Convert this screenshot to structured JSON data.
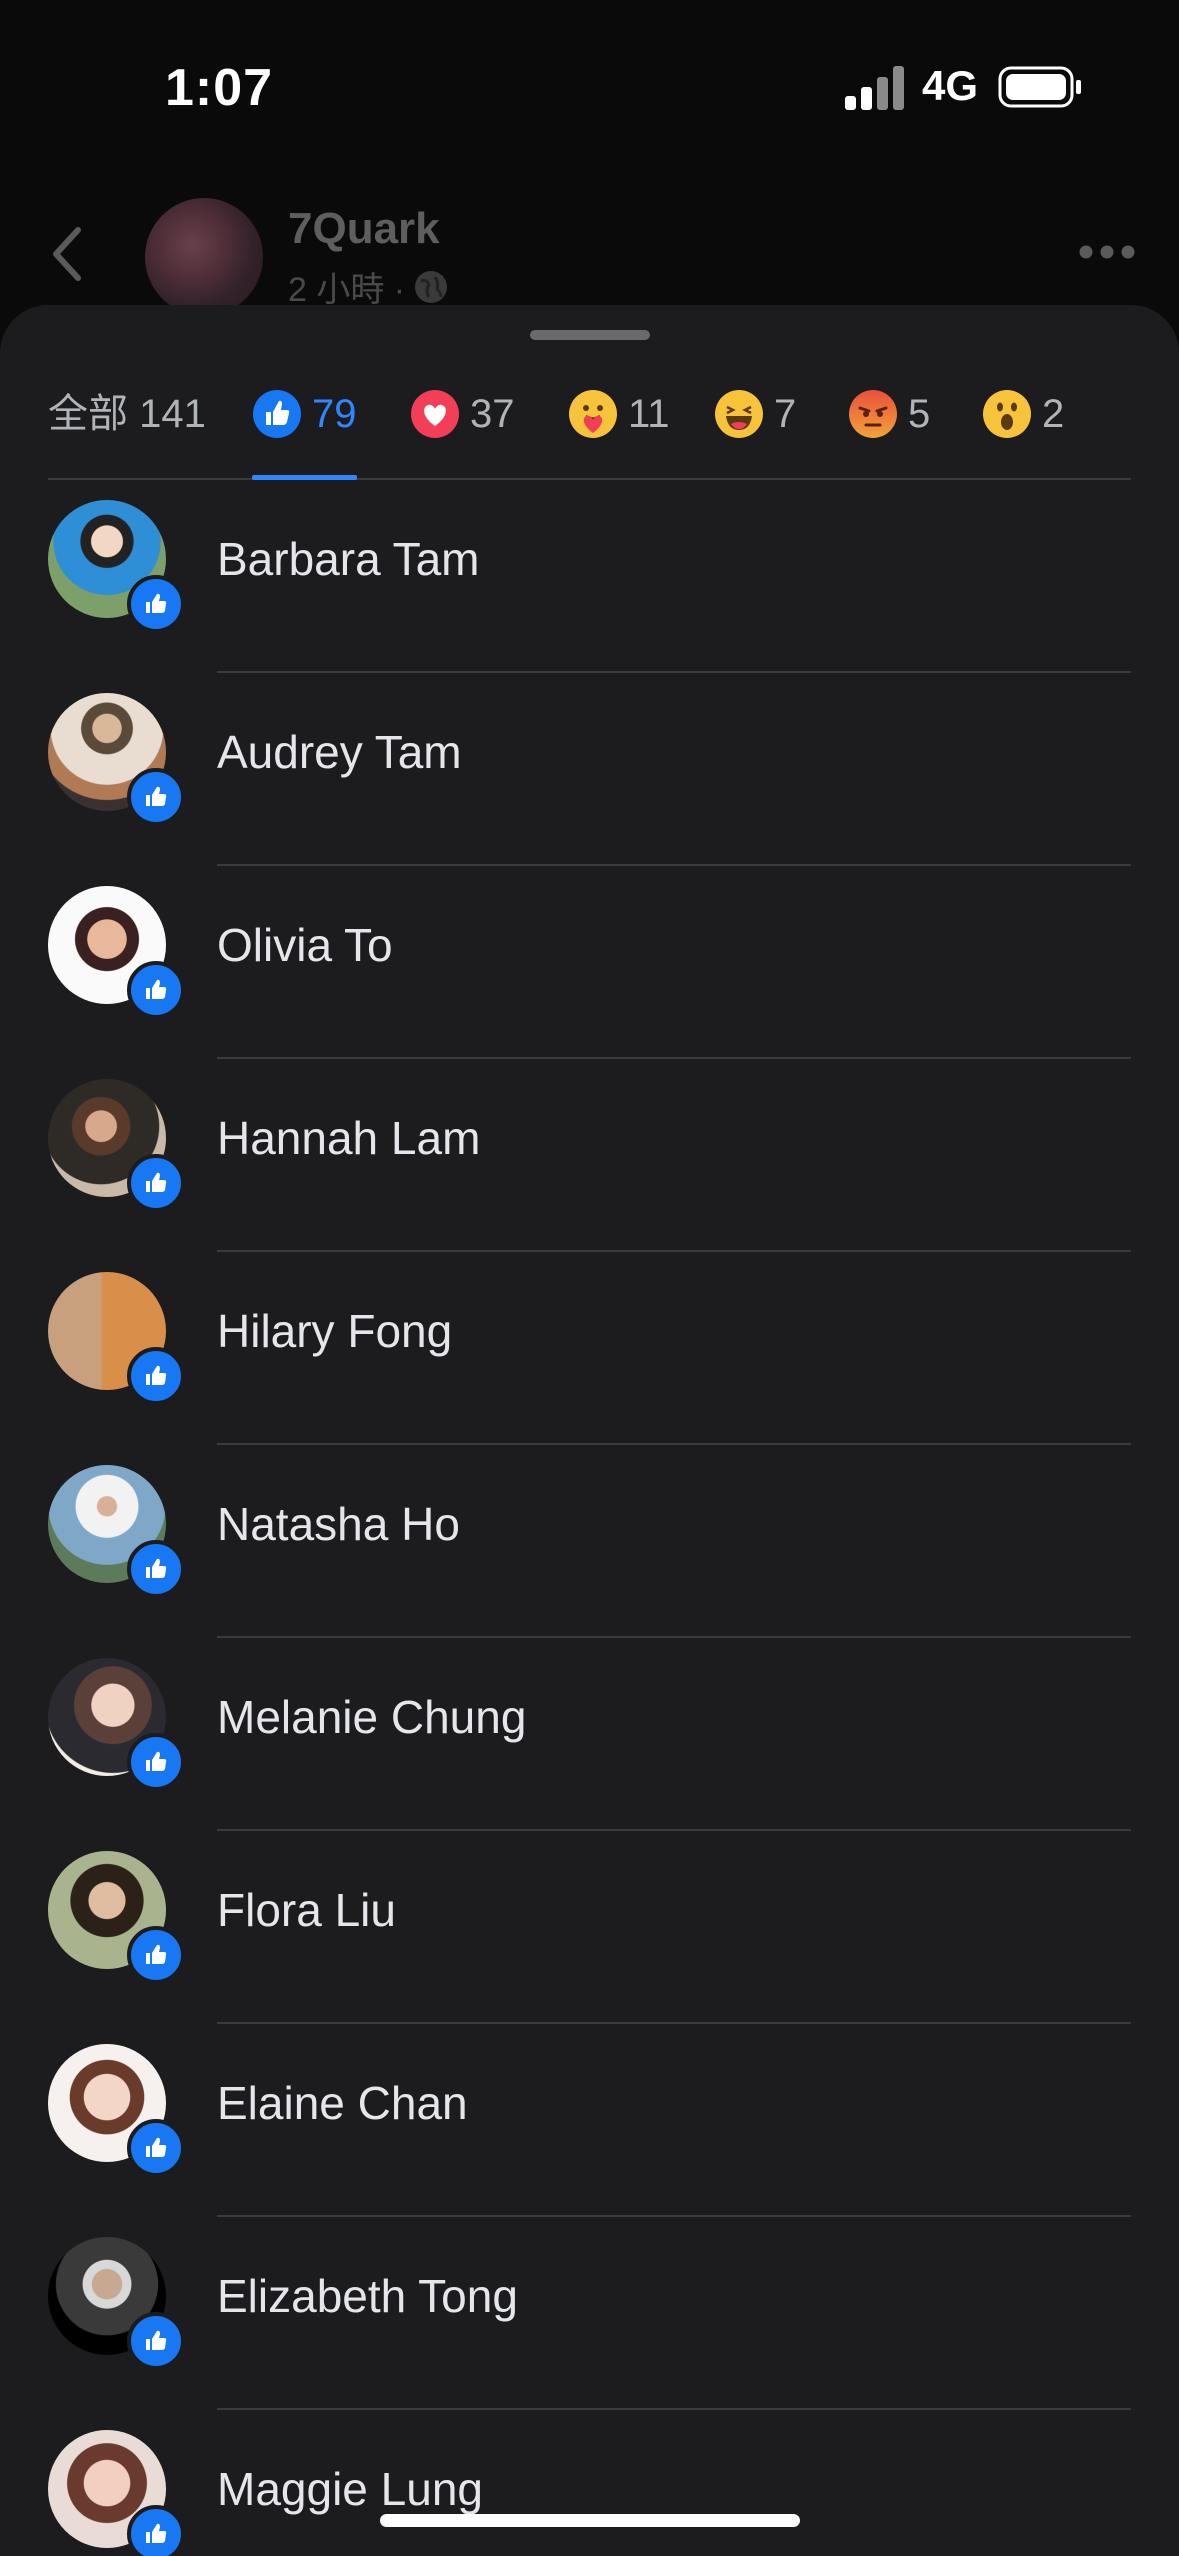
{
  "status_bar": {
    "time": "1:07",
    "network": "4G"
  },
  "post_header": {
    "author": "7Quark",
    "meta": "2 小時 ·"
  },
  "tabs": [
    {
      "label": "全部 141",
      "icon": "none",
      "active": false
    },
    {
      "label": "79",
      "icon": "like-icon",
      "active": true
    },
    {
      "label": "37",
      "icon": "love-icon",
      "active": false
    },
    {
      "label": "11",
      "icon": "care-icon",
      "active": false
    },
    {
      "label": "7",
      "icon": "haha-icon",
      "active": false
    },
    {
      "label": "5",
      "icon": "angry-icon",
      "active": false
    },
    {
      "label": "2",
      "icon": "wow-icon",
      "active": false
    }
  ],
  "people": [
    {
      "name": "Barbara Tam",
      "reaction": "like-icon"
    },
    {
      "name": "Audrey Tam",
      "reaction": "like-icon"
    },
    {
      "name": "Olivia To",
      "reaction": "like-icon"
    },
    {
      "name": "Hannah Lam",
      "reaction": "like-icon"
    },
    {
      "name": "Hilary Fong",
      "reaction": "like-icon"
    },
    {
      "name": "Natasha Ho",
      "reaction": "like-icon"
    },
    {
      "name": "Melanie Chung",
      "reaction": "like-icon"
    },
    {
      "name": "Flora Liu",
      "reaction": "like-icon"
    },
    {
      "name": "Elaine Chan",
      "reaction": "like-icon"
    },
    {
      "name": "Elizabeth Tong",
      "reaction": "like-icon"
    },
    {
      "name": "Maggie Lung",
      "reaction": "like-icon"
    }
  ],
  "colors": {
    "accent": "#2d88ff",
    "like_badge": "#1877f2",
    "sheet_bg": "#1c1c1e"
  }
}
